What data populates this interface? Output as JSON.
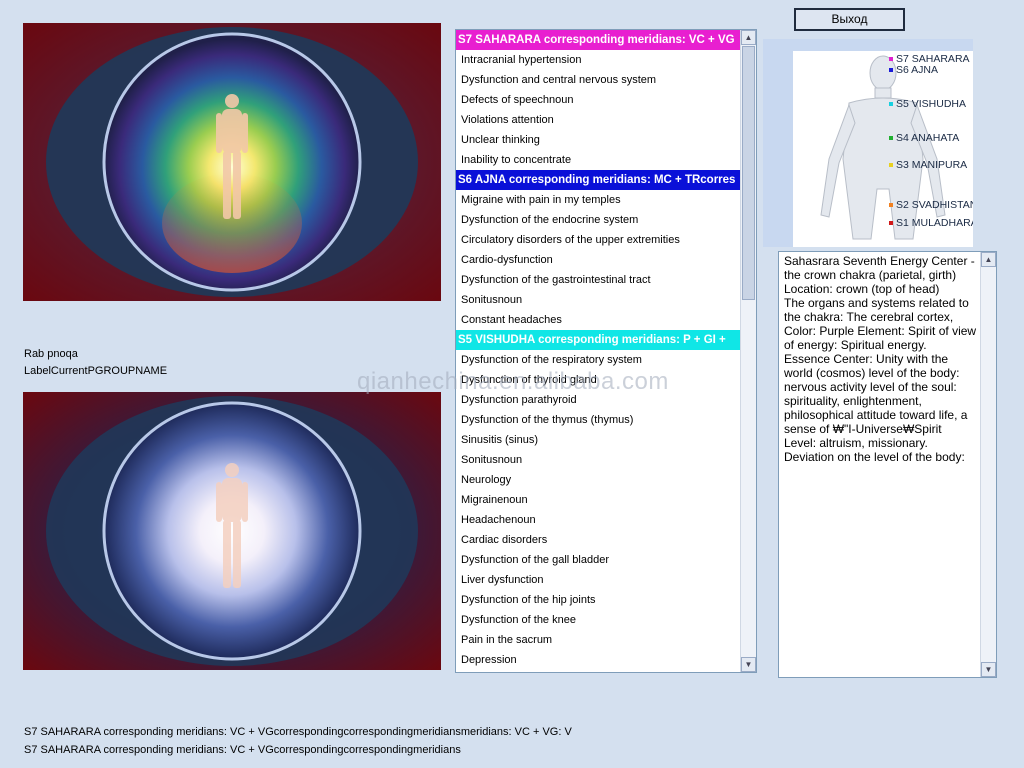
{
  "window": {
    "exit_label": "Выход"
  },
  "labels": {
    "group_name": "Rab pnoqa",
    "current_group": "LabelCurrentPGROUPNAME"
  },
  "images": {
    "top": "aura-colorful-figure",
    "bottom": "aura-white-figure"
  },
  "list": {
    "rows": [
      {
        "type": "header",
        "text": "S7 SAHARARA corresponding meridians: VC + VG",
        "color": "#e81fd0"
      },
      {
        "type": "item",
        "text": "Intracranial hypertension"
      },
      {
        "type": "item",
        "text": "Dysfunction and central nervous system"
      },
      {
        "type": "item",
        "text": "Defects of speechnoun"
      },
      {
        "type": "item",
        "text": "Violations attention"
      },
      {
        "type": "item",
        "text": "Unclear thinking"
      },
      {
        "type": "item",
        "text": "Inability to concentrate"
      },
      {
        "type": "header",
        "text": "S6 AJNA corresponding meridians: MC + TRcorres",
        "color": "#0a10d8"
      },
      {
        "type": "item",
        "text": "Migraine with pain in my temples"
      },
      {
        "type": "item",
        "text": "Dysfunction of the endocrine system"
      },
      {
        "type": "item",
        "text": "Circulatory disorders of the upper extremities"
      },
      {
        "type": "item",
        "text": "Cardio-dysfunction"
      },
      {
        "type": "item",
        "text": "Dysfunction of the gastrointestinal tract"
      },
      {
        "type": "item",
        "text": "Sonitusnoun"
      },
      {
        "type": "item",
        "text": "Constant headaches"
      },
      {
        "type": "header",
        "text": "S5 VISHUDHA corresponding meridians: P + GI +",
        "color": "#10e6e6"
      },
      {
        "type": "item",
        "text": "Dysfunction of the respiratory system"
      },
      {
        "type": "item",
        "text": "Dysfunction of thyroid gland"
      },
      {
        "type": "item",
        "text": "Dysfunction parathyroid"
      },
      {
        "type": "item",
        "text": "Dysfunction of the thymus (thymus)"
      },
      {
        "type": "item",
        "text": "Sinusitis (sinus)"
      },
      {
        "type": "item",
        "text": "Sonitusnoun"
      },
      {
        "type": "item",
        "text": "Neurology"
      },
      {
        "type": "item",
        "text": "Migrainenoun"
      },
      {
        "type": "item",
        "text": "Headachenoun"
      },
      {
        "type": "item",
        "text": "Cardiac disorders"
      },
      {
        "type": "item",
        "text": "Dysfunction of the gall bladder"
      },
      {
        "type": "item",
        "text": "Liver dysfunction"
      },
      {
        "type": "item",
        "text": "Dysfunction of the hip joints"
      },
      {
        "type": "item",
        "text": "Dysfunction of the knee"
      },
      {
        "type": "item",
        "text": "Pain in the sacrum"
      },
      {
        "type": "item",
        "text": "Depression"
      }
    ]
  },
  "bodymap": {
    "chakras": [
      {
        "label": "S7 SAHARARA",
        "color": "#e01fd0"
      },
      {
        "label": "S6 AJNA",
        "color": "#1a1ad8"
      },
      {
        "label": "S5 VISHUDHA",
        "color": "#18d0e0"
      },
      {
        "label": "S4 ANAHATA",
        "color": "#20b030"
      },
      {
        "label": "S3 MANIPURA",
        "color": "#e8d020"
      },
      {
        "label": "S2 SVADHISTAN",
        "color": "#f08020"
      },
      {
        "label": "S1 MULADHARA",
        "color": "#d01818"
      }
    ]
  },
  "description": {
    "text": "Sahasrara Seventh Energy Center - the crown chakra (parietal, girth)\nLocation: crown (top of head)\nThe organs and systems related to the chakra: The cerebral cortex,\nColor: Purple Element: Spirit of view of energy: Spiritual energy.\nEssence Center: Unity with the world (cosmos) level of the body: nervous activity level of the soul: spirituality, enlightenment, philosophical attitude toward life, a sense of ₩\"I-Universe₩Spirit\nLevel: altruism, missionary.\nDeviation on the level of the body:"
  },
  "status": {
    "line1": "S7 SAHARARA corresponding meridians: VC + VGcorrespondingcorrespondingmeridiansmeridians: VC + VG: V",
    "line2": "S7 SAHARARA corresponding meridians: VC + VGcorrespondingcorrespondingmeridians"
  },
  "watermark": "qianhechina.en.alibaba.com"
}
